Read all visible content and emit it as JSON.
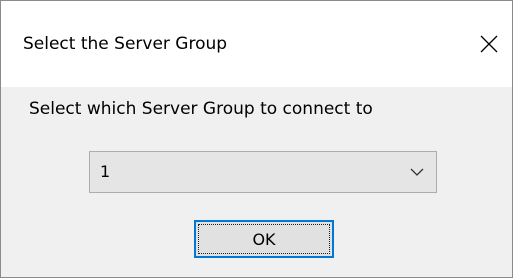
{
  "dialog": {
    "title": "Select the Server Group",
    "prompt": "Select which Server Group to connect to",
    "server_group_select": {
      "selected_value": "1",
      "icon": "chevron-down-icon"
    },
    "ok_label": "OK",
    "close_icon": "close-icon"
  },
  "colors": {
    "title_bar": "#ffffff",
    "dialog_body": "#f0f0f0",
    "focus_border": "#0078d7",
    "button_face": "#e1e1e1",
    "select_face": "#e5e5e5"
  }
}
